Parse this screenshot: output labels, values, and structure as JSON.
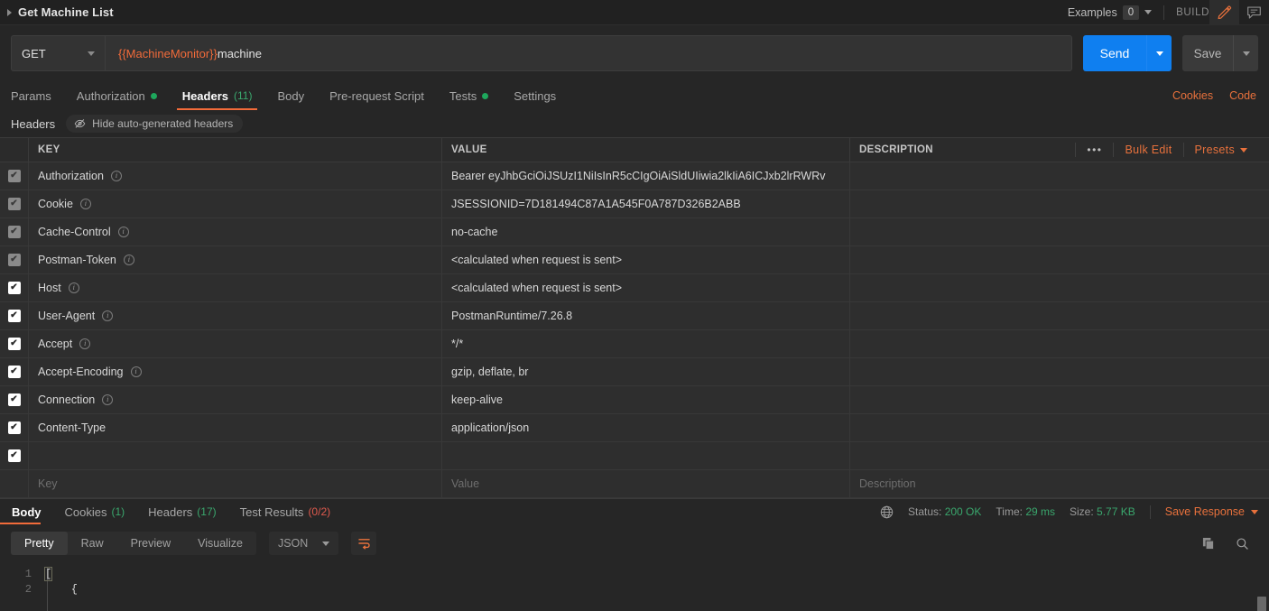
{
  "topbar": {
    "request_title": "Get Machine List",
    "examples_label": "Examples",
    "examples_count": "0",
    "build_label": "BUILD",
    "edit_icon": "pencil-icon",
    "comment_icon": "comment-icon"
  },
  "request": {
    "method": "GET",
    "url_variable": "{{MachineMonitor}}",
    "url_rest": "machine",
    "send_label": "Send",
    "save_label": "Save"
  },
  "request_tabs": [
    {
      "label": "Params",
      "active": false,
      "badge": "",
      "dot": false
    },
    {
      "label": "Authorization",
      "active": false,
      "badge": "",
      "dot": true
    },
    {
      "label": "Headers",
      "active": true,
      "badge": "(11)",
      "dot": false
    },
    {
      "label": "Body",
      "active": false,
      "badge": "",
      "dot": false
    },
    {
      "label": "Pre-request Script",
      "active": false,
      "badge": "",
      "dot": false
    },
    {
      "label": "Tests",
      "active": false,
      "badge": "",
      "dot": true
    },
    {
      "label": "Settings",
      "active": false,
      "badge": "",
      "dot": false
    }
  ],
  "request_tabs_right": {
    "cookies_label": "Cookies",
    "code_label": "Code"
  },
  "headers_panel": {
    "section_label": "Headers",
    "hide_auto_label": "Hide auto-generated headers",
    "hide_auto_icon": "eye-slash-icon",
    "columns": {
      "key": "KEY",
      "value": "VALUE",
      "description": "DESCRIPTION"
    },
    "actions": {
      "more_icon": "ellipsis-icon",
      "bulk_edit": "Bulk Edit",
      "presets": "Presets"
    },
    "rows": [
      {
        "checked": true,
        "auto": true,
        "key": "Authorization",
        "info": true,
        "value": "Bearer eyJhbGciOiJSUzI1NiIsInR5cCIgOiAiSldUIiwia2lkIiA6ICJxb2lrRWRv",
        "description": ""
      },
      {
        "checked": true,
        "auto": true,
        "key": "Cookie",
        "info": true,
        "value": "JSESSIONID=7D181494C87A1A545F0A787D326B2ABB",
        "description": ""
      },
      {
        "checked": true,
        "auto": true,
        "key": "Cache-Control",
        "info": true,
        "value": "no-cache",
        "description": ""
      },
      {
        "checked": true,
        "auto": true,
        "key": "Postman-Token",
        "info": true,
        "value": "<calculated when request is sent>",
        "description": ""
      },
      {
        "checked": true,
        "auto": false,
        "key": "Host",
        "info": true,
        "value": "<calculated when request is sent>",
        "description": ""
      },
      {
        "checked": true,
        "auto": false,
        "key": "User-Agent",
        "info": true,
        "value": "PostmanRuntime/7.26.8",
        "description": ""
      },
      {
        "checked": true,
        "auto": false,
        "key": "Accept",
        "info": true,
        "value": "*/*",
        "description": ""
      },
      {
        "checked": true,
        "auto": false,
        "key": "Accept-Encoding",
        "info": true,
        "value": "gzip, deflate, br",
        "description": ""
      },
      {
        "checked": true,
        "auto": false,
        "key": "Connection",
        "info": true,
        "value": "keep-alive",
        "description": ""
      },
      {
        "checked": true,
        "auto": false,
        "key": "Content-Type",
        "info": false,
        "value": "application/json",
        "description": ""
      },
      {
        "checked": true,
        "auto": false,
        "key": "",
        "info": false,
        "value": "",
        "description": ""
      }
    ],
    "new_row_placeholders": {
      "key": "Key",
      "value": "Value",
      "description": "Description"
    }
  },
  "response_tabs": [
    {
      "label": "Body",
      "badge": "",
      "badge_type": "",
      "active": true
    },
    {
      "label": "Cookies",
      "badge": "(1)",
      "badge_type": "green",
      "active": false
    },
    {
      "label": "Headers",
      "badge": "(17)",
      "badge_type": "green",
      "active": false
    },
    {
      "label": "Test Results",
      "badge": "(0/2)",
      "badge_type": "red",
      "active": false
    }
  ],
  "response_meta": {
    "globe_icon": "globe-icon",
    "status_label": "Status:",
    "status_value": "200 OK",
    "time_label": "Time:",
    "time_value": "29 ms",
    "size_label": "Size:",
    "size_value": "5.77 KB",
    "save_response_label": "Save Response"
  },
  "body_toolbar": {
    "views": [
      {
        "label": "Pretty",
        "active": true
      },
      {
        "label": "Raw",
        "active": false
      },
      {
        "label": "Preview",
        "active": false
      },
      {
        "label": "Visualize",
        "active": false
      }
    ],
    "format": "JSON",
    "wrap_icon": "word-wrap-icon",
    "copy_icon": "copy-icon",
    "search_icon": "search-icon"
  },
  "response_body": {
    "lines": [
      {
        "num": "1",
        "text": "["
      },
      {
        "num": "2",
        "text": "    {"
      }
    ]
  },
  "colors": {
    "accent_orange": "#f26b3a",
    "send_blue": "#0f7ff0",
    "status_green": "#3aa76d",
    "error_red": "#e05a4e",
    "panel_bg": "#262626",
    "row_bg": "#2e2e2e"
  }
}
